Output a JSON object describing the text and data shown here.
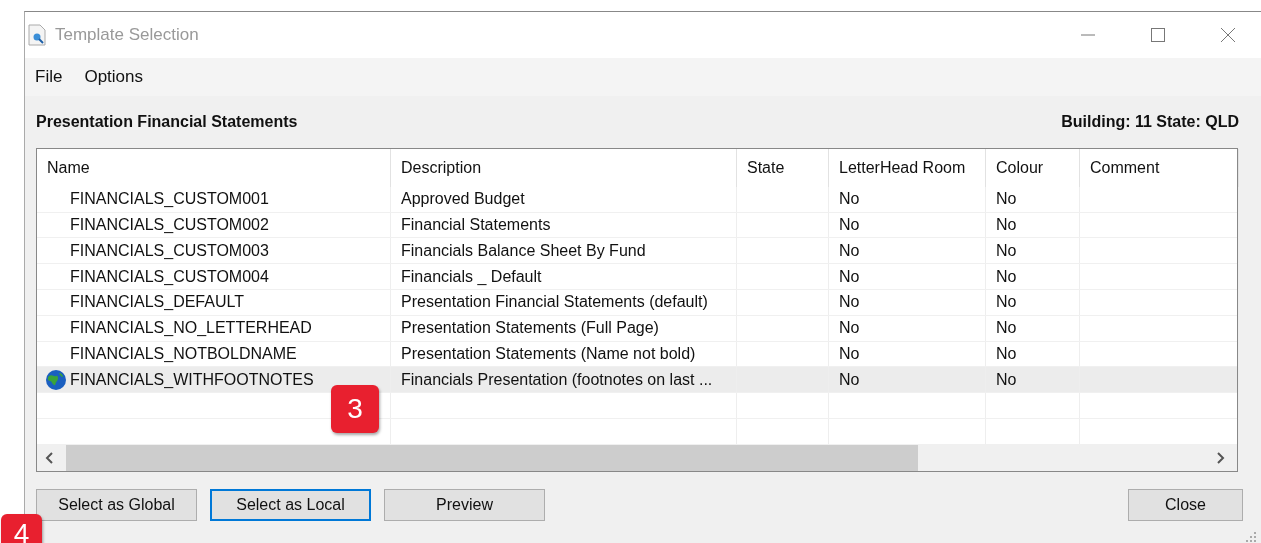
{
  "window": {
    "title": "Template Selection"
  },
  "menu": [
    "File",
    "Options"
  ],
  "heading": "Presentation Financial Statements",
  "location": "Building: 11 State: QLD",
  "table": {
    "columns": [
      "Name",
      "Description",
      "State",
      "LetterHead Room",
      "Colour",
      "Comment"
    ],
    "rows": [
      {
        "cells": [
          "FINANCIALS_CUSTOM001",
          "Approved Budget",
          "",
          "No",
          "No",
          ""
        ],
        "global": false,
        "selected": false
      },
      {
        "cells": [
          "FINANCIALS_CUSTOM002",
          "Financial Statements",
          "",
          "No",
          "No",
          ""
        ],
        "global": false,
        "selected": false
      },
      {
        "cells": [
          "FINANCIALS_CUSTOM003",
          "Financials Balance Sheet By Fund",
          "",
          "No",
          "No",
          ""
        ],
        "global": false,
        "selected": false
      },
      {
        "cells": [
          "FINANCIALS_CUSTOM004",
          "Financials _ Default",
          "",
          "No",
          "No",
          ""
        ],
        "global": false,
        "selected": false
      },
      {
        "cells": [
          "FINANCIALS_DEFAULT",
          "Presentation Financial Statements (default)",
          "",
          "No",
          "No",
          ""
        ],
        "global": false,
        "selected": false
      },
      {
        "cells": [
          "FINANCIALS_NO_LETTERHEAD",
          "Presentation Statements (Full Page)",
          "",
          "No",
          "No",
          ""
        ],
        "global": false,
        "selected": false
      },
      {
        "cells": [
          "FINANCIALS_NOTBOLDNAME",
          "Presentation Statements (Name not bold)",
          "",
          "No",
          "No",
          ""
        ],
        "global": false,
        "selected": false
      },
      {
        "cells": [
          "FINANCIALS_WITHFOOTNOTES",
          "Financials Presentation (footnotes on last ...",
          "",
          "No",
          "No",
          ""
        ],
        "global": true,
        "selected": true
      }
    ]
  },
  "buttons": [
    {
      "label": "Select as Global",
      "focused": false
    },
    {
      "label": "Select as Local",
      "focused": true
    },
    {
      "label": "Preview",
      "focused": false
    }
  ],
  "close_button": "Close",
  "callouts": [
    "3",
    "4"
  ]
}
